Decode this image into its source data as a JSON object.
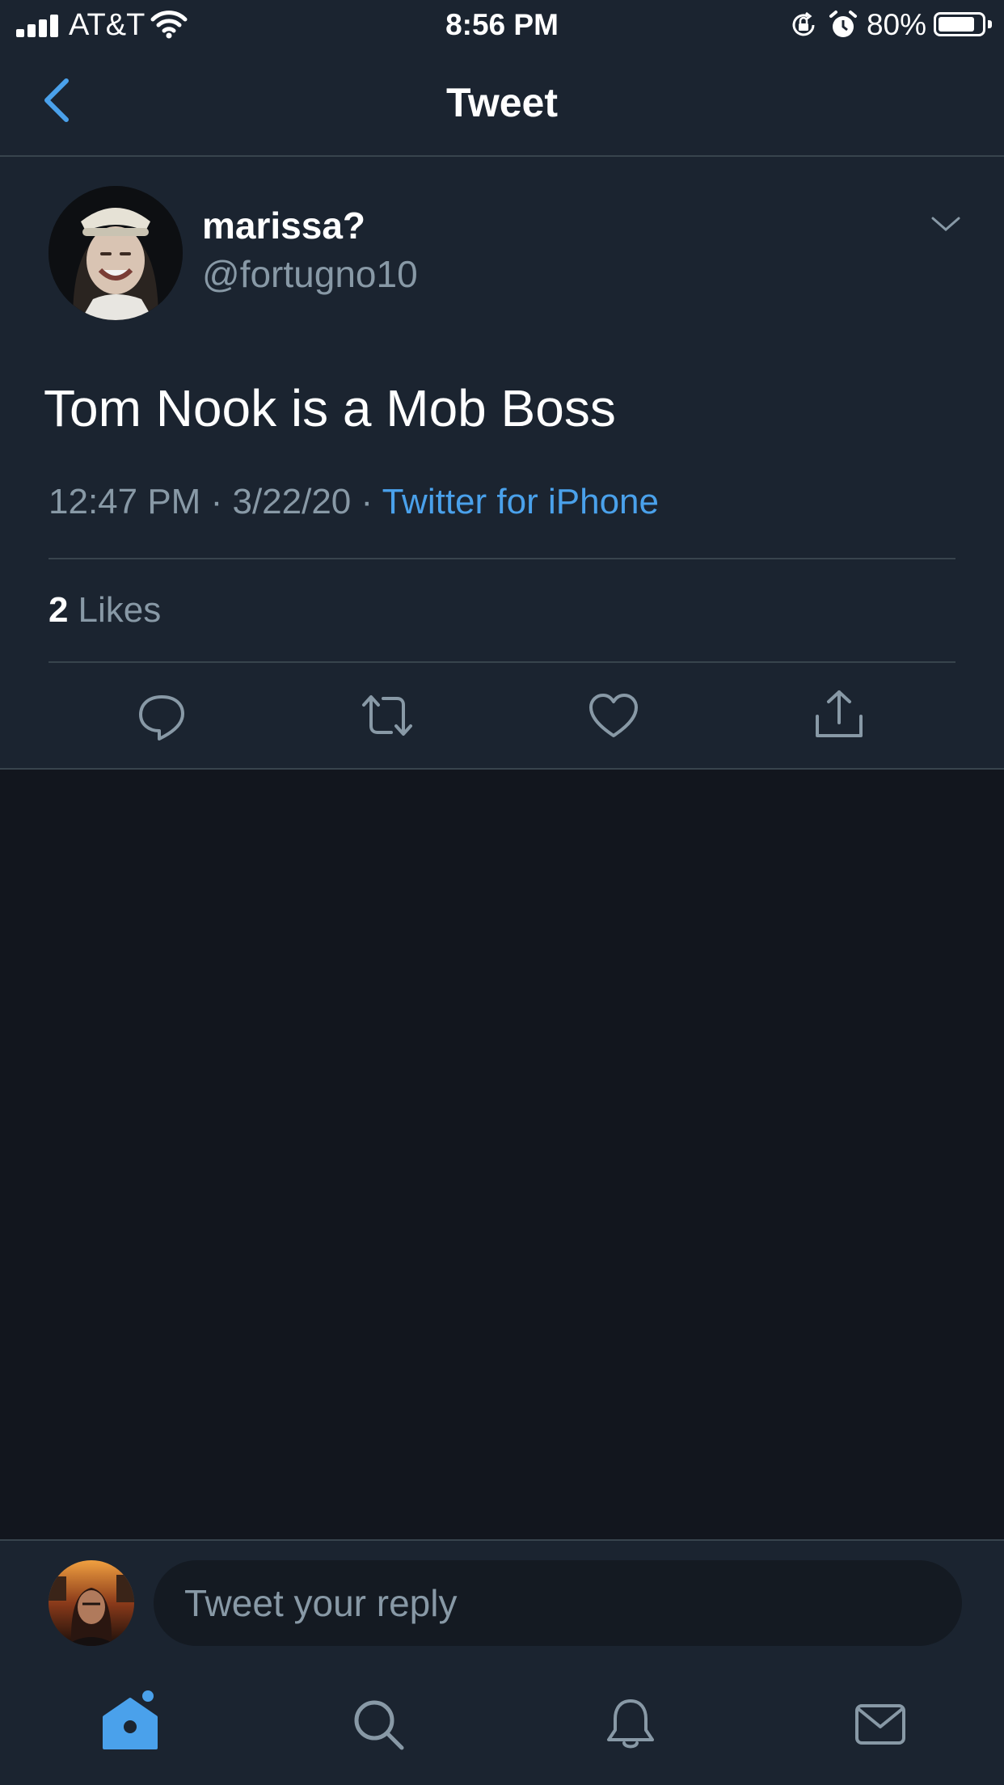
{
  "status_bar": {
    "carrier": "AT&T",
    "time": "8:56 PM",
    "battery": "80%",
    "icons": [
      "signal-icon",
      "wifi-icon",
      "rotation-lock-icon",
      "alarm-icon",
      "battery-icon"
    ]
  },
  "header": {
    "title": "Tweet",
    "back_icon": "chevron-left-icon"
  },
  "tweet": {
    "author_name": "marissa?",
    "author_handle": "@fortugno10",
    "text": "Tom Nook is a Mob Boss",
    "time": "12:47 PM",
    "separator": "·",
    "date": "3/22/20",
    "source": "Twitter for iPhone",
    "likes_count": "2",
    "likes_label": "Likes",
    "actions": [
      "reply-icon",
      "retweet-icon",
      "like-icon",
      "share-icon"
    ]
  },
  "reply": {
    "placeholder": "Tweet your reply"
  },
  "tab_bar": {
    "items": [
      "home-icon",
      "search-icon",
      "notifications-icon",
      "messages-icon"
    ],
    "active": "home-icon"
  },
  "colors": {
    "accent": "#4aa1eb",
    "background": "#1b2430",
    "muted_text": "#8899a6",
    "divider": "#38444d"
  }
}
